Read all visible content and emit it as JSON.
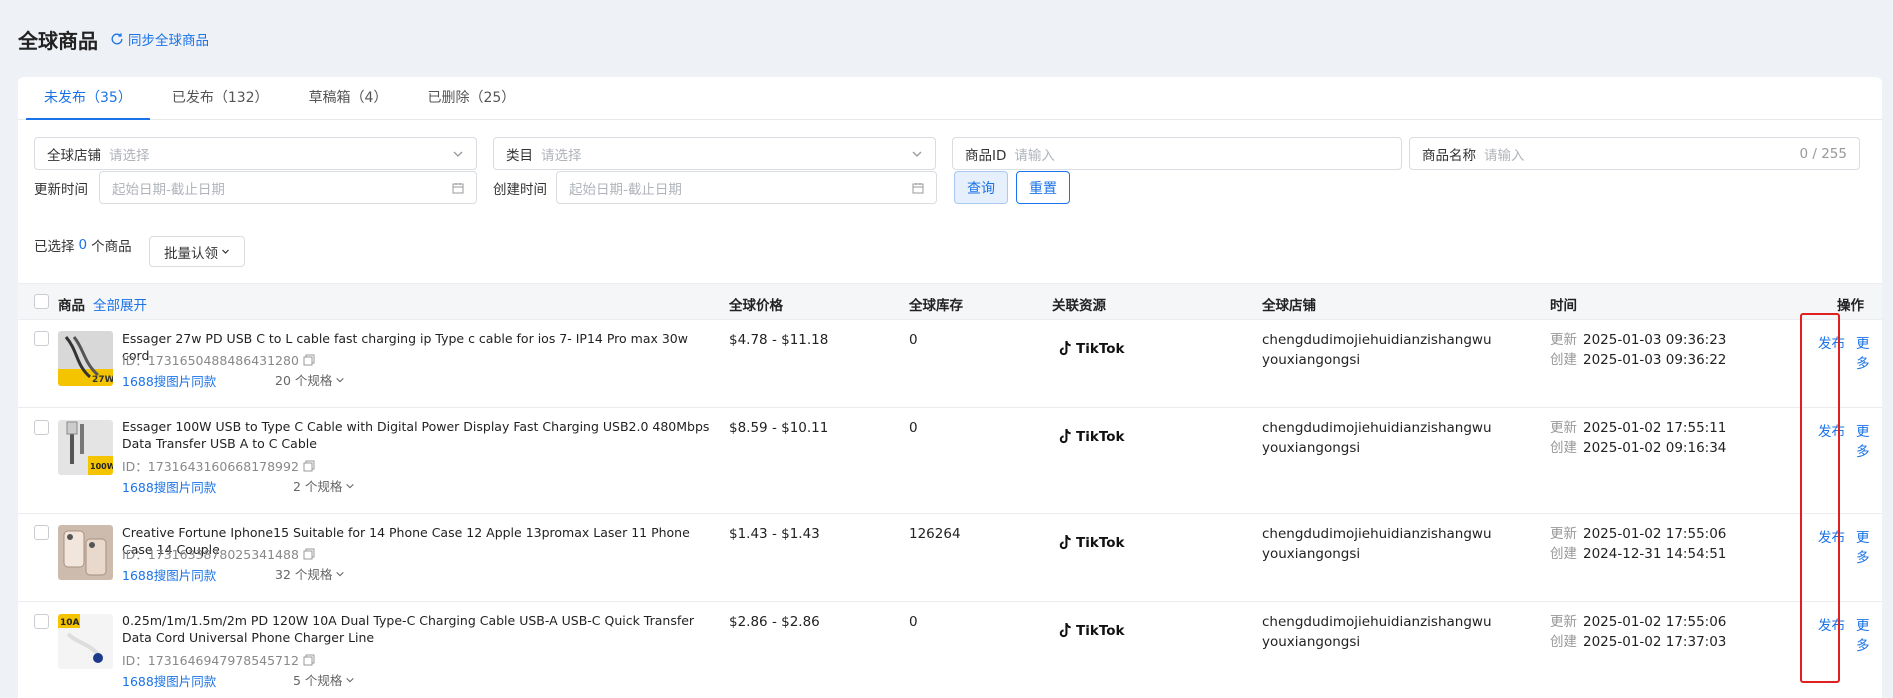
{
  "header": {
    "title": "全球商品",
    "sync_label": "同步全球商品"
  },
  "tabs": [
    {
      "label": "未发布（35）",
      "active": true
    },
    {
      "label": "已发布（132）",
      "active": false
    },
    {
      "label": "草稿箱（4）",
      "active": false
    },
    {
      "label": "已删除（25）",
      "active": false
    }
  ],
  "filters": {
    "shop": {
      "label": "全球店铺",
      "placeholder": "请选择"
    },
    "category": {
      "label": "类目",
      "placeholder": "请选择"
    },
    "product_id": {
      "label": "商品ID",
      "placeholder": "请输入"
    },
    "product_name": {
      "label": "商品名称",
      "placeholder": "请输入",
      "counter": "0 / 255"
    },
    "update_time": {
      "label": "更新时间",
      "placeholder": "起始日期-截止日期"
    },
    "create_time": {
      "label": "创建时间",
      "placeholder": "起始日期-截止日期"
    },
    "query_label": "查询",
    "reset_label": "重置"
  },
  "selection": {
    "prefix": "已选择",
    "count": "0",
    "suffix": "个商品",
    "batch_label": "批量认领"
  },
  "table": {
    "columns": {
      "product": "商品",
      "expand_all": "全部展开",
      "price": "全球价格",
      "stock": "全球库存",
      "resource": "关联资源",
      "shop": "全球店铺",
      "time": "时间",
      "actions": "操作"
    },
    "rows": [
      {
        "name": "Essager 27w PD USB C to L cable fast charging ip Type c cable for ios 7- IP14 Pro max 30w cord",
        "id": "ID：1731650488486431280",
        "image_search": "1688搜图片同款",
        "spec": "20 个规格",
        "price": "$4.78 - $11.18",
        "stock": "0",
        "resource": "TikTok",
        "shop": "chengdudimojiehuidianzishangwuyouxiangongsi",
        "updated_label": "更新",
        "updated": "2025-01-03 09:36:23",
        "created_label": "创建",
        "created": "2025-01-03 09:36:22",
        "publish": "发布",
        "more": "更多"
      },
      {
        "name": "Essager 100W USB to Type C Cable with Digital Power Display Fast Charging USB2.0 480Mbps Data Transfer USB A to C Cable",
        "id": "ID：1731643160668178992",
        "image_search": "1688搜图片同款",
        "spec": "2 个规格",
        "price": "$8.59 - $10.11",
        "stock": "0",
        "resource": "TikTok",
        "shop": "chengdudimojiehuidianzishangwuyouxiangongsi",
        "updated_label": "更新",
        "updated": "2025-01-02 17:55:11",
        "created_label": "创建",
        "created": "2025-01-02 09:16:34",
        "publish": "发布",
        "more": "更多"
      },
      {
        "name": "Creative Fortune Iphone15 Suitable for 14 Phone Case 12 Apple 13promax Laser 11 Phone Case 14 Couple",
        "id": "ID：1731633878025341488",
        "image_search": "1688搜图片同款",
        "spec": "32 个规格",
        "price": "$1.43 - $1.43",
        "stock": "126264",
        "resource": "TikTok",
        "shop": "chengdudimojiehuidianzishangwuyouxiangongsi",
        "updated_label": "更新",
        "updated": "2025-01-02 17:55:06",
        "created_label": "创建",
        "created": "2024-12-31 14:54:51",
        "publish": "发布",
        "more": "更多"
      },
      {
        "name": "0.25m/1m/1.5m/2m PD 120W 10A Dual Type-C Charging Cable USB-A USB-C Quick Transfer Data Cord Universal Phone Charger Line",
        "id": "ID：1731646947978545712",
        "image_search": "1688搜图片同款",
        "spec": "5 个规格",
        "price": "$2.86 - $2.86",
        "stock": "0",
        "resource": "TikTok",
        "shop": "chengdudimojiehuidianzishangwuyouxiangongsi",
        "updated_label": "更新",
        "updated": "2025-01-02 17:55:06",
        "created_label": "创建",
        "created": "2025-01-02 17:37:03",
        "publish": "发布",
        "more": "更多"
      }
    ]
  },
  "colors": {
    "accent": "#1a73e8",
    "highlight": "#e02020"
  }
}
